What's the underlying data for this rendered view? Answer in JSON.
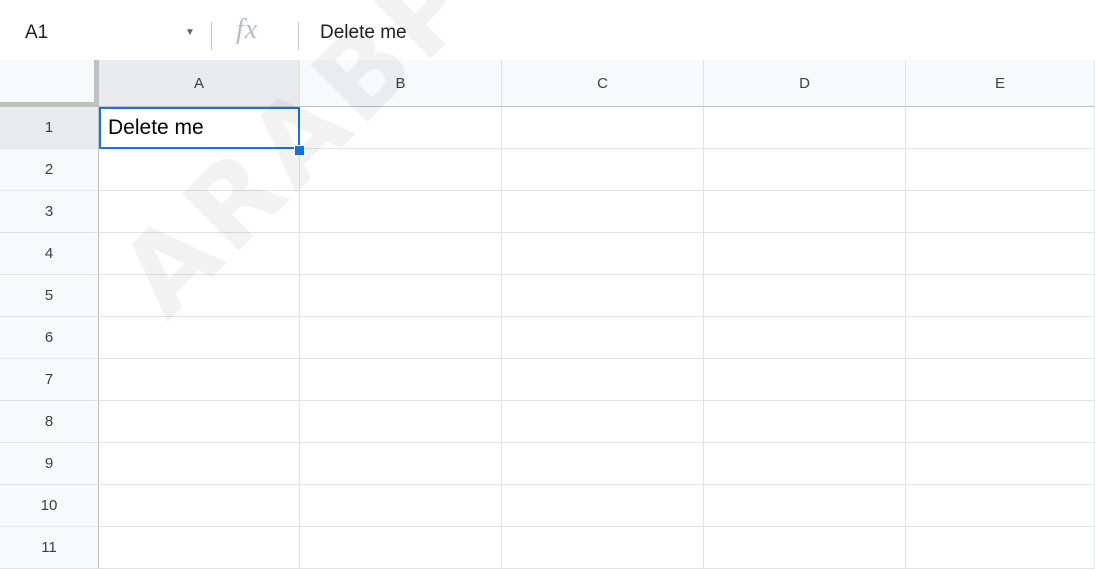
{
  "formula_bar": {
    "cell_reference": "A1",
    "fx_label": "fx",
    "formula_value": "Delete me"
  },
  "columns": [
    "A",
    "B",
    "C",
    "D",
    "E"
  ],
  "rows": [
    "1",
    "2",
    "3",
    "4",
    "5",
    "6",
    "7",
    "8",
    "9",
    "10",
    "11"
  ],
  "cells": {
    "A1": "Delete me"
  },
  "selection": {
    "active_cell": "A1"
  },
  "watermark": "ARABPSYCHO",
  "colors": {
    "selection": "#1a73e8",
    "header_bg": "#f8f9fa",
    "gridline": "#e2e3e3"
  }
}
